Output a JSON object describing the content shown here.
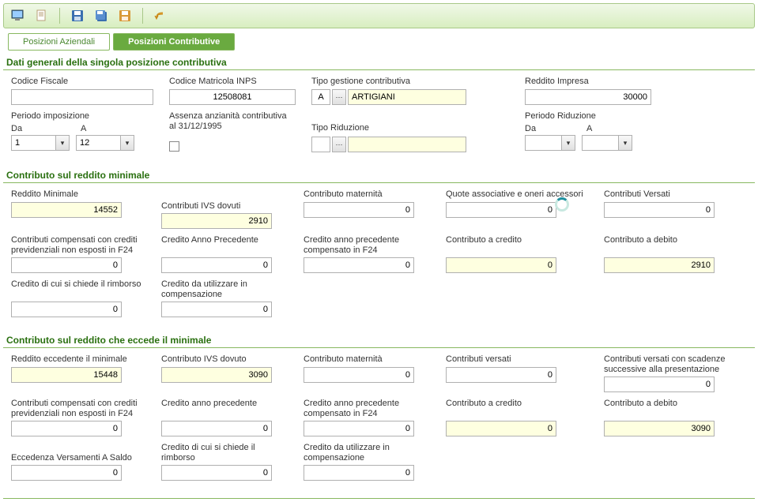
{
  "tabs": {
    "inactive": "Posizioni Aziendali",
    "active": "Posizioni Contributive"
  },
  "section1": {
    "title": "Dati generali della singola posizione contributiva",
    "codice_fiscale_label": "Codice Fiscale",
    "codice_fiscale": "",
    "matricola_label": "Codice Matricola INPS",
    "matricola": "12508081",
    "tipo_gestione_label": "Tipo gestione contributiva",
    "tipo_gestione_code": "A",
    "tipo_gestione_desc": "ARTIGIANI",
    "reddito_impresa_label": "Reddito Impresa",
    "reddito_impresa": "30000",
    "periodo_imposizione_label": "Periodo imposizione",
    "da_label": "Da",
    "a_label": "A",
    "periodo_da": "1",
    "periodo_a": "12",
    "assenza_label": "Assenza anzianità contributiva al 31/12/1995",
    "tipo_riduzione_label": "Tipo Riduzione",
    "tipo_riduzione_code": "",
    "tipo_riduzione_desc": "",
    "periodo_riduzione_label": "Periodo Riduzione",
    "periodo_rid_da": "",
    "periodo_rid_a": ""
  },
  "section2": {
    "title": "Contributo sul reddito minimale",
    "reddito_min_label": "Reddito Minimale",
    "reddito_min": "14552",
    "ivs_dovuti_label": "Contributi IVS dovuti",
    "ivs_dovuti": "2910",
    "maternita_label": "Contributo maternità",
    "maternita": "0",
    "quote_label": "Quote associative e oneri accessori",
    "quote": "0",
    "versati_label": "Contributi Versati",
    "versati": "0",
    "compensati_label": "Contributi compensati con crediti previdenziali non esposti in F24",
    "compensati": "0",
    "credito_prec_label": "Credito Anno Precedente",
    "credito_prec": "0",
    "credito_prec_f24_label": "Credito anno precedente compensato in F24",
    "credito_prec_f24": "0",
    "contributo_credito_label": "Contributo a credito",
    "contributo_credito": "0",
    "contributo_debito_label": "Contributo a debito",
    "contributo_debito": "2910",
    "credito_rimborso_label": "Credito di cui si chiede il rimborso",
    "credito_rimborso": "0",
    "credito_comp_label": "Credito da utilizzare in compensazione",
    "credito_comp": "0"
  },
  "section3": {
    "title": "Contributo sul reddito che eccede il minimale",
    "reddito_ecc_label": "Reddito eccedente il minimale",
    "reddito_ecc": "15448",
    "ivs_dovuto_label": "Contributo IVS dovuto",
    "ivs_dovuto": "3090",
    "maternita_label": "Contributo maternità",
    "maternita": "0",
    "versati_label": "Contributi versati",
    "versati": "0",
    "versati_succ_label": "Contributi versati con scadenze successive alla presentazione",
    "versati_succ": "0",
    "compensati_label": "Contributi compensati con crediti previdenziali non esposti in F24",
    "compensati": "0",
    "credito_prec_label": "Credito anno precedente",
    "credito_prec": "0",
    "credito_prec_f24_label": "Credito anno precedente compensato in F24",
    "credito_prec_f24": "0",
    "contributo_credito_label": "Contributo a credito",
    "contributo_credito": "0",
    "contributo_debito_label": "Contributo a debito",
    "contributo_debito": "3090",
    "eccedenza_label": "Eccedenza Versamenti A Saldo",
    "eccedenza": "0",
    "credito_rimborso_label": "Credito di cui si chiede il rimborso",
    "credito_rimborso": "0",
    "credito_comp_label": "Credito da utilizzare in compensazione",
    "credito_comp": "0"
  }
}
